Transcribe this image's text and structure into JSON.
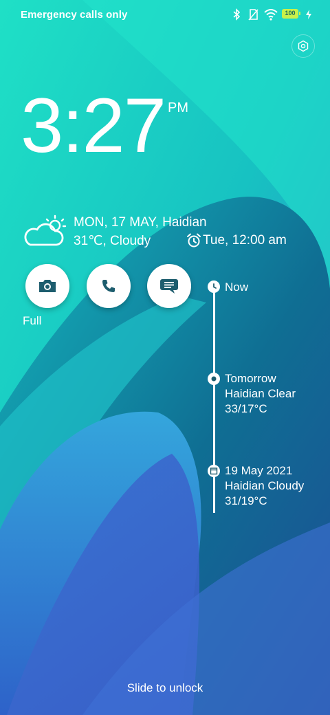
{
  "status_bar": {
    "carrier_text": "Emergency calls only",
    "battery_level": "100",
    "icons": [
      "bluetooth-icon",
      "no-sim-icon",
      "wifi-icon",
      "battery-icon",
      "charging-bolt-icon"
    ]
  },
  "lock_screen": {
    "time": "3:27",
    "ampm": "PM",
    "date_location": "MON, 17 MAY, Haidian",
    "weather_now": "31℃, Cloudy",
    "alarm": "Tue, 12:00 am",
    "weather_icon": "partly-cloudy-icon",
    "shortcuts": [
      {
        "icon": "camera-icon",
        "label": "Full"
      },
      {
        "icon": "phone-icon"
      },
      {
        "icon": "message-icon"
      }
    ],
    "timeline": [
      {
        "icon": "clock-icon",
        "lines": [
          "Now"
        ]
      },
      {
        "icon": "weather-icon",
        "lines": [
          "Tomorrow",
          "Haidian Clear",
          "33/17°C"
        ]
      },
      {
        "icon": "calendar-icon",
        "lines": [
          "19 May 2021",
          "Haidian Cloudy",
          "31/19°C"
        ]
      }
    ],
    "unlock_hint": "Slide to unlock"
  },
  "colors": {
    "accent_teal": "#1fd6c4",
    "deep_blue": "#2f5fc8",
    "icon_dark": "#1d5d6e"
  }
}
